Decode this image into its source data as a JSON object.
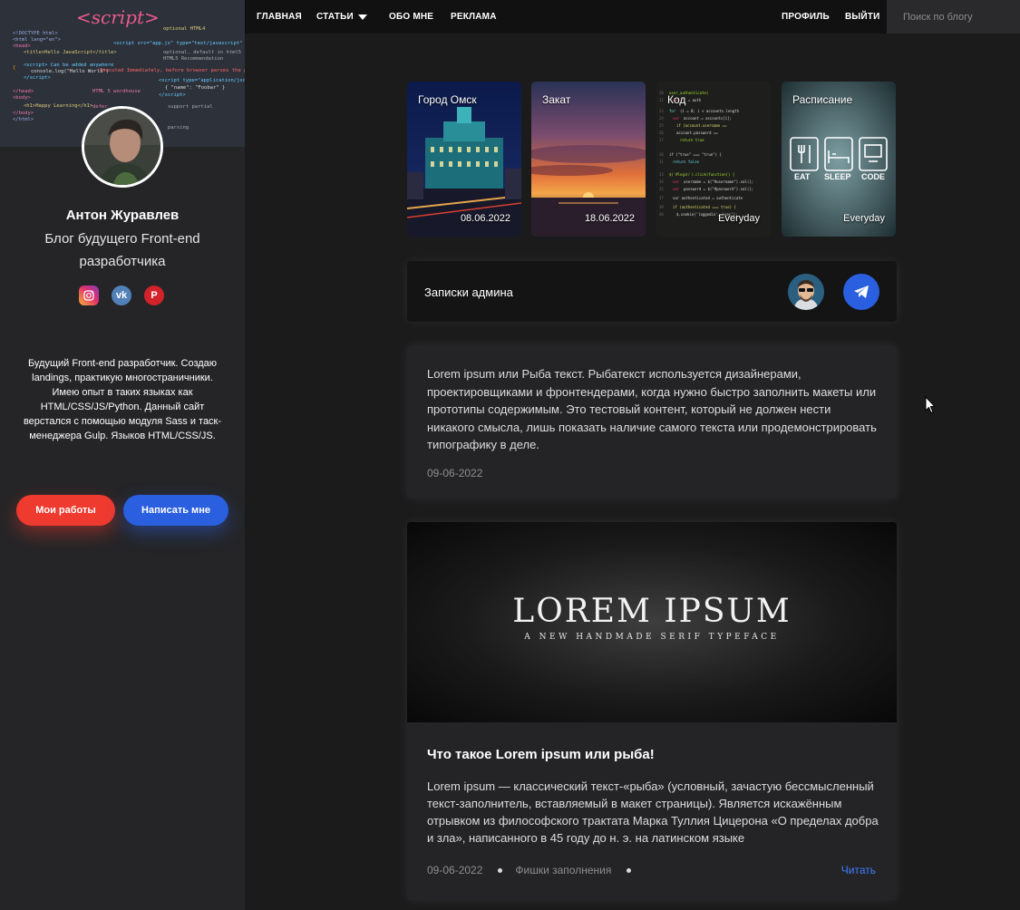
{
  "nav": {
    "main": "ГЛАВНАЯ",
    "articles": "СТАТЬИ",
    "about": "ОБО МНЕ",
    "ads": "РЕКЛАМА",
    "profile": "ПРОФИЛЬ",
    "logout": "ВЫЙТИ",
    "search_placeholder": "Поиск по блогу"
  },
  "sidebar": {
    "cover_text": "<script>",
    "name": "Антон Журавлев",
    "subtitle": "Блог будущего Front-end разработчика",
    "socials": [
      "instagram-icon",
      "vk-icon",
      "pinterest-icon"
    ],
    "description": "Будущий Front-end разработчик. Создаю landings, практикую многостраничники. Имею опыт в таких языках как HTML/CSS/JS/Python. Данный сайт верстался с помощью модуля Sass и таск-менеджера Gulp. Языков HTML/CSS/JS.",
    "btn_works": "Мои работы",
    "btn_write": "Написать мне"
  },
  "stories": [
    {
      "title": "Город Омск",
      "date": "08.06.2022"
    },
    {
      "title": "Закат",
      "date": "18.06.2022"
    },
    {
      "title": "Код",
      "date": "Everyday"
    },
    {
      "title": "Расписание",
      "date": "Everyday",
      "labels": [
        "EAT",
        "SLEEP",
        "CODE"
      ]
    }
  ],
  "admin": {
    "title": "Записки админа"
  },
  "posts": [
    {
      "text": "Lorem ipsum или Рыба текст. Рыбатекст используется дизайнерами, проектировщиками и фронтендерами, когда нужно быстро заполнить макеты или прототипы содержимым. Это тестовый контент, который не должен нести никакого смысла, лишь показать наличие самого текста или продемонстрировать типографику в деле.",
      "date": "09-06-2022"
    },
    {
      "image_title": "LOREM IPSUM",
      "image_subtitle": "A NEW HANDMADE SERIF TYPEFACE",
      "title": "Что такое Lorem ipsum или рыба!",
      "text": "Lorem ipsum — классический текст-«рыба» (условный, зачастую бессмысленный текст-заполнитель, вставляемый в макет страницы). Является искажённым отрывком из философского трактата Марка Туллия Цицерона «О пределах добра и зла», написанного в 45 году до н. э. на латинском языке",
      "date": "09-06-2022",
      "category": "Фишки заполнения",
      "read": "Читать"
    }
  ],
  "colors": {
    "accent_blue": "#2a5fe0",
    "accent_red": "#ee3a2f",
    "link": "#3d7dff"
  }
}
